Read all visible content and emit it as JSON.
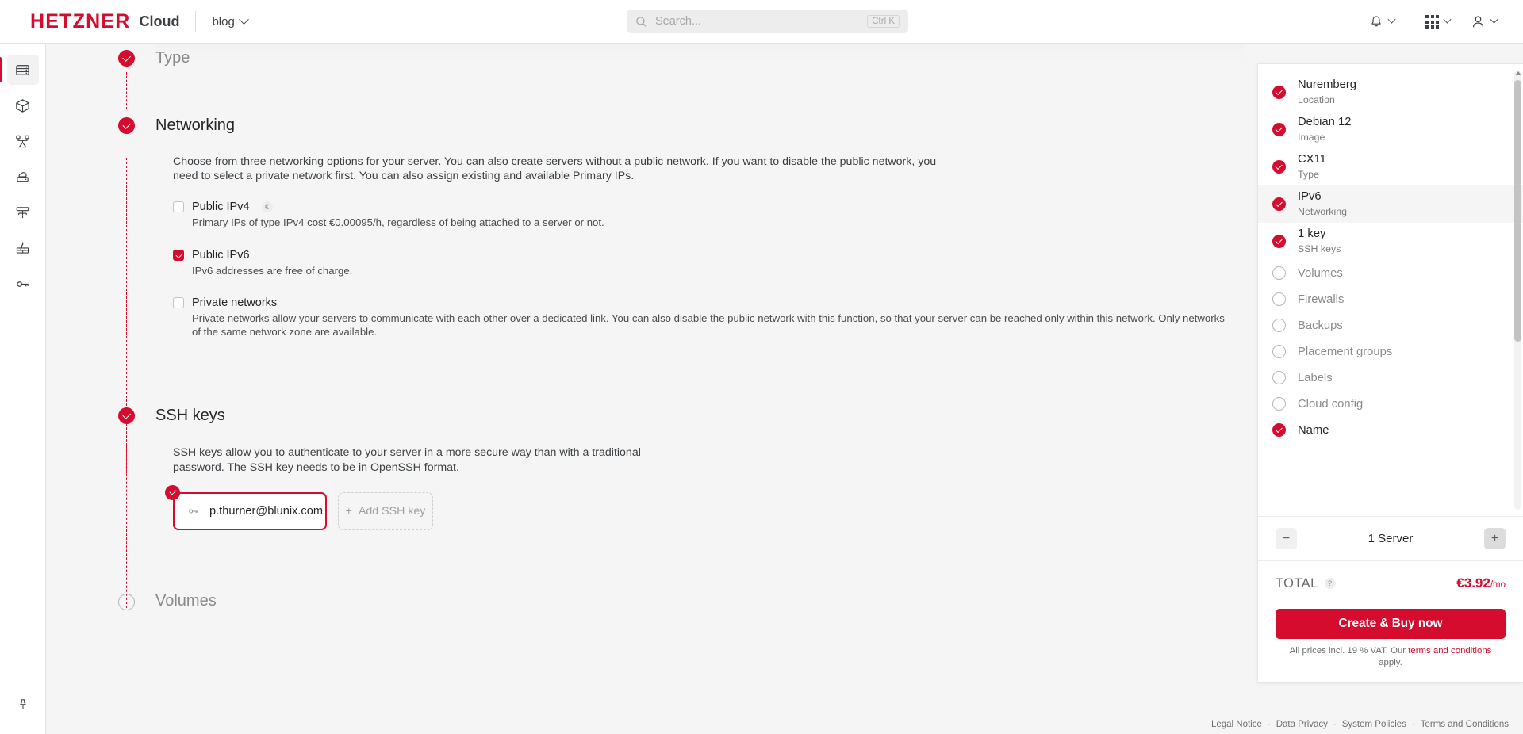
{
  "header": {
    "logo_primary": "HETZNER",
    "logo_secondary": "Cloud",
    "project_selector": "blog",
    "search_placeholder": "Search...",
    "search_shortcut": "Ctrl K",
    "icons": {
      "search": "search-icon",
      "bell": "notification-bell-icon",
      "apps": "apps-grid-icon",
      "user": "user-avatar-icon"
    }
  },
  "sidebar": {
    "items": [
      {
        "name": "servers",
        "icon": "server-icon",
        "active": true
      },
      {
        "name": "volumes",
        "icon": "cube-icon",
        "active": false
      },
      {
        "name": "load-balancers",
        "icon": "load-balancer-icon",
        "active": false
      },
      {
        "name": "storage-boxes",
        "icon": "cloud-storage-icon",
        "active": false
      },
      {
        "name": "networks",
        "icon": "network-icon",
        "active": false
      },
      {
        "name": "firewalls",
        "icon": "firewall-icon",
        "active": false
      },
      {
        "name": "ssh-keys",
        "icon": "key-icon",
        "active": false
      }
    ],
    "bottom_item": {
      "name": "pin",
      "icon": "pin-icon"
    }
  },
  "wizard": {
    "type_step": {
      "title": "Type",
      "state": "done"
    },
    "networking": {
      "title": "Networking",
      "state": "done",
      "description": "Choose from three networking options for your server. You can also create servers without a public network. If you want to disable the public network, you need to select a private network first. You can also assign existing and available Primary IPs.",
      "options": [
        {
          "label": "Public IPv4",
          "checked": false,
          "badge": "€",
          "sub": "Primary IPs of type IPv4 cost €0.00095/h, regardless of being attached to a server or not."
        },
        {
          "label": "Public IPv6",
          "checked": true,
          "badge": "",
          "sub": "IPv6 addresses are free of charge."
        },
        {
          "label": "Private networks",
          "checked": false,
          "badge": "",
          "sub": "Private networks allow your servers to communicate with each other over a dedicated link. You can also disable the public network with this function, so that your server can be reached only within this network. Only networks of the same network zone are available."
        }
      ]
    },
    "ssh_keys": {
      "title": "SSH keys",
      "state": "done",
      "description": "SSH keys allow you to authenticate to your server in a more secure way than with a traditional password. The SSH key needs to be in OpenSSH format.",
      "selected_key": "p.thurner@blunix.com",
      "add_button": "Add SSH key"
    },
    "volumes": {
      "title": "Volumes",
      "state": "empty"
    }
  },
  "summary": {
    "items": [
      {
        "value": "Nuremberg",
        "label": "Location",
        "state": "done",
        "highlighted": false
      },
      {
        "value": "Debian 12",
        "label": "Image",
        "state": "done",
        "highlighted": false
      },
      {
        "value": "CX11",
        "label": "Type",
        "state": "done",
        "highlighted": false
      },
      {
        "value": "IPv6",
        "label": "Networking",
        "state": "done",
        "highlighted": true
      },
      {
        "value": "1 key",
        "label": "SSH keys",
        "state": "done",
        "highlighted": false
      },
      {
        "value": "Volumes",
        "label": "",
        "state": "empty",
        "highlighted": false
      },
      {
        "value": "Firewalls",
        "label": "",
        "state": "empty",
        "highlighted": false
      },
      {
        "value": "Backups",
        "label": "",
        "state": "empty",
        "highlighted": false
      },
      {
        "value": "Placement groups",
        "label": "",
        "state": "empty",
        "highlighted": false
      },
      {
        "value": "Labels",
        "label": "",
        "state": "empty",
        "highlighted": false
      },
      {
        "value": "Cloud config",
        "label": "",
        "state": "empty",
        "highlighted": false
      },
      {
        "value": "Name",
        "label": "",
        "state": "done",
        "highlighted": false
      }
    ],
    "counter": {
      "decrement": "−",
      "increment": "+",
      "label": "1 Server"
    },
    "total_label": "TOTAL",
    "total_help": "?",
    "total_price": "€3.92",
    "total_period": "/mo",
    "buy_button": "Create & Buy now",
    "vat_note_prefix": "All prices incl. 19 % VAT. Our ",
    "vat_note_link": "terms and conditions",
    "vat_note_suffix": " apply."
  },
  "footer": {
    "links": [
      "Legal Notice",
      "Data Privacy",
      "System Policies",
      "Terms and Conditions"
    ],
    "separator": "·"
  },
  "colors": {
    "brand_red": "#d50c2d",
    "page_bg": "#f5f5f5",
    "panel_bg": "#ffffff"
  }
}
